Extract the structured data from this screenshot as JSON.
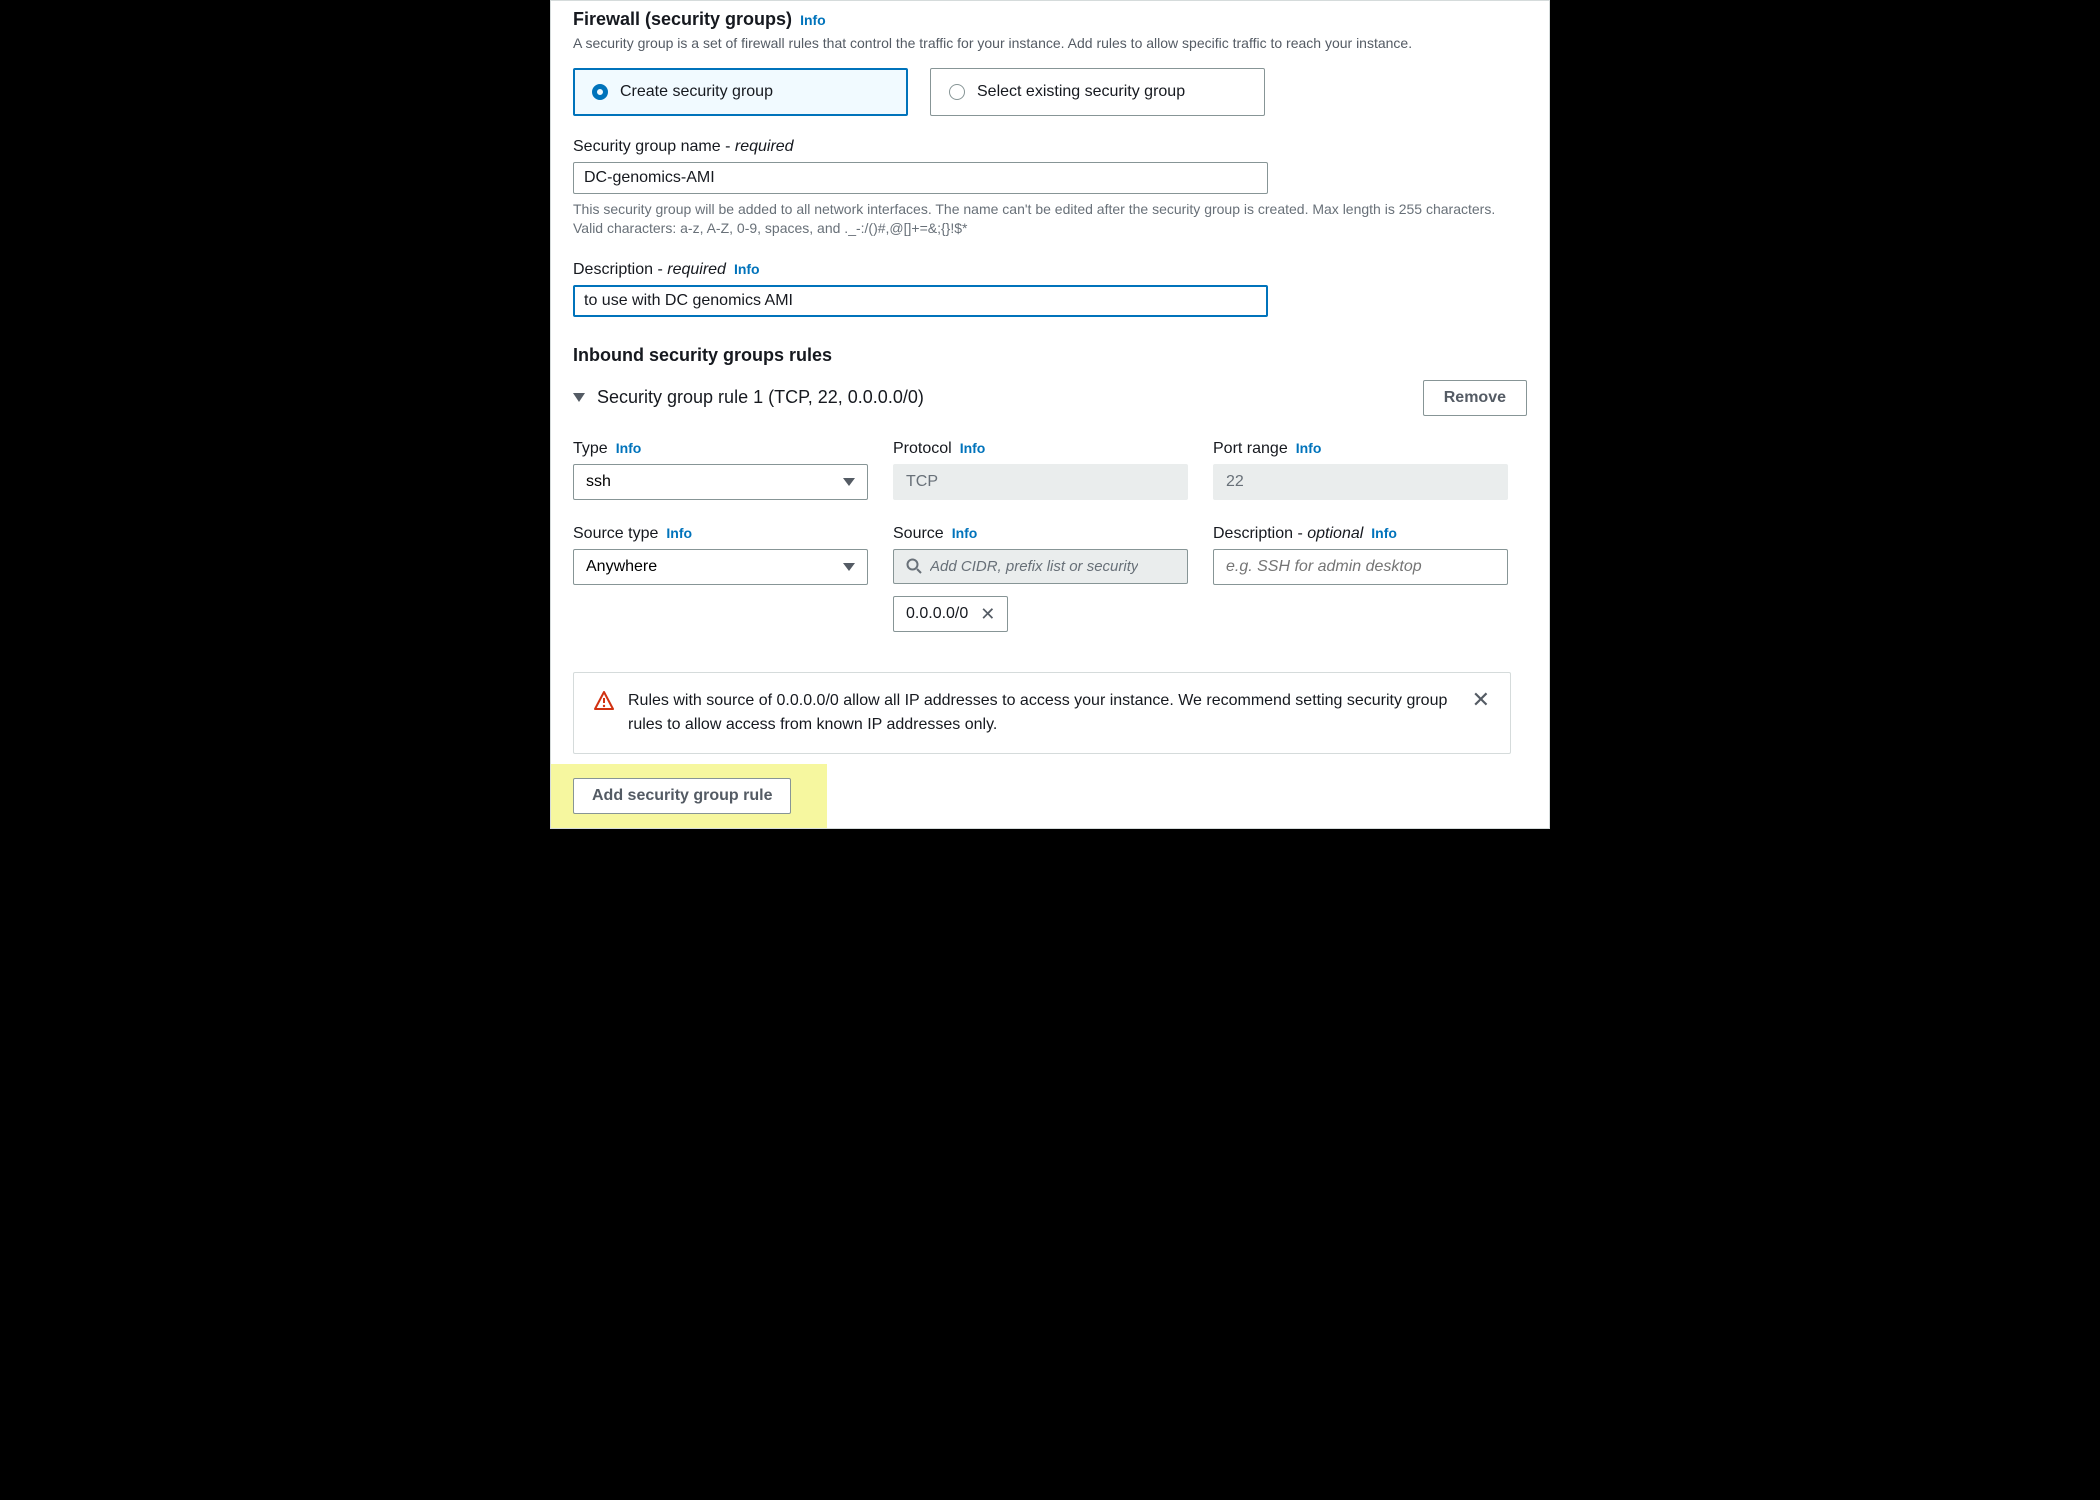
{
  "header": {
    "title": "Firewall (security groups)",
    "info": "Info",
    "description": "A security group is a set of firewall rules that control the traffic for your instance. Add rules to allow specific traffic to reach your instance."
  },
  "sg_choice": {
    "create_label": "Create security group",
    "select_label": "Select existing security group"
  },
  "name_field": {
    "label": "Security group name - ",
    "required": "required",
    "value": "DC-genomics-AMI",
    "help": "This security group will be added to all network interfaces. The name can't be edited after the security group is created. Max length is 255 characters. Valid characters: a-z, A-Z, 0-9, spaces, and ._-:/()#,@[]+=&;{}!$*"
  },
  "desc_field": {
    "label": "Description - ",
    "required": "required",
    "info": "Info",
    "value": "to use with DC genomics AMI"
  },
  "inbound": {
    "title": "Inbound security groups rules",
    "rule_title": "Security group rule 1 (TCP, 22, 0.0.0.0/0)",
    "remove": "Remove"
  },
  "rule_fields": {
    "type": {
      "label": "Type",
      "info": "Info",
      "value": "ssh"
    },
    "protocol": {
      "label": "Protocol",
      "info": "Info",
      "value": "TCP"
    },
    "port": {
      "label": "Port range",
      "info": "Info",
      "value": "22"
    },
    "source_type": {
      "label": "Source type",
      "info": "Info",
      "value": "Anywhere"
    },
    "source": {
      "label": "Source",
      "info": "Info",
      "placeholder": "Add CIDR, prefix list or security",
      "token_value": "0.0.0.0/0"
    },
    "rule_desc": {
      "label": "Description - ",
      "optional": "optional",
      "info": "Info",
      "placeholder": "e.g. SSH for admin desktop"
    }
  },
  "warning": {
    "text": "Rules with source of 0.0.0.0/0 allow all IP addresses to access your instance. We recommend setting security group rules to allow access from known IP addresses only."
  },
  "add_rule": "Add security group rule"
}
